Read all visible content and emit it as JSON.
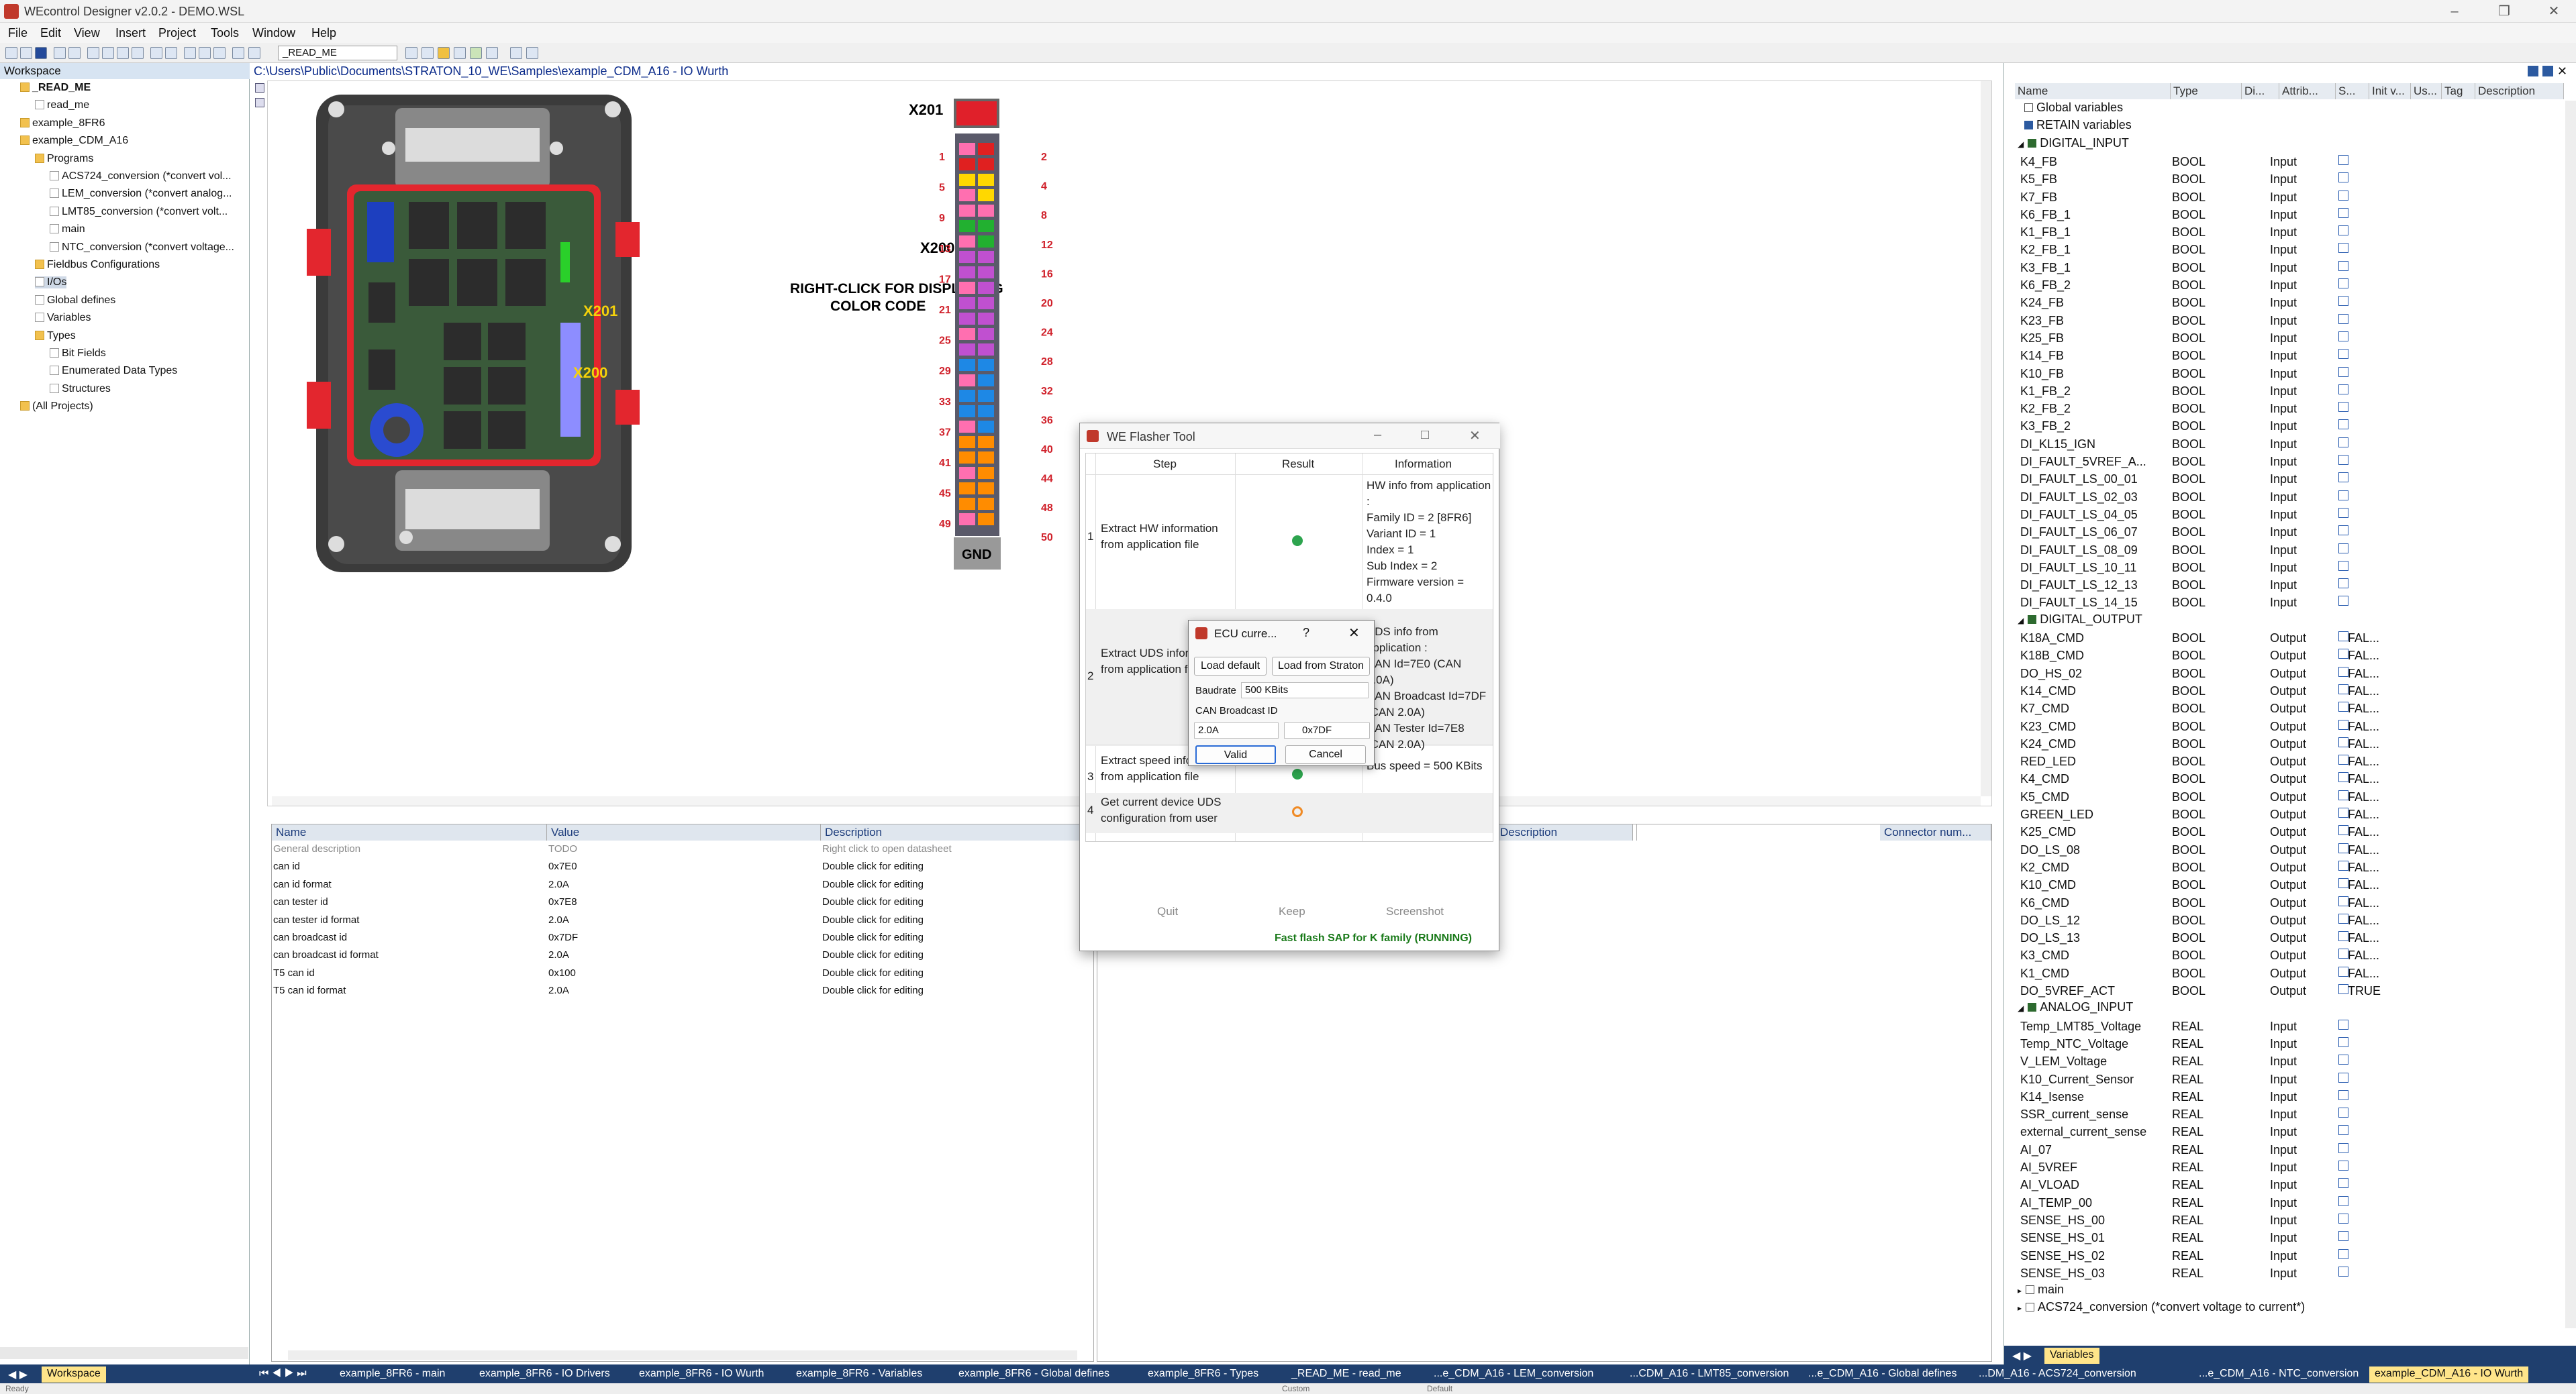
{
  "window": {
    "title": "WEcontrol Designer v2.0.2 - DEMO.WSL"
  },
  "menu": [
    "File",
    "Edit",
    "View",
    "Insert",
    "Project",
    "Tools",
    "Window",
    "Help"
  ],
  "toolbar": {
    "combo": "_READ_ME"
  },
  "workspace": {
    "header": "Workspace",
    "items": [
      {
        "label": "_READ_ME",
        "level": 0,
        "bold": true
      },
      {
        "label": "read_me",
        "level": 1
      },
      {
        "label": "example_8FR6",
        "level": 0
      },
      {
        "label": "example_CDM_A16",
        "level": 0
      },
      {
        "label": "Programs",
        "level": 1
      },
      {
        "label": "ACS724_conversion (*convert vol...",
        "level": 2
      },
      {
        "label": "LEM_conversion (*convert analog...",
        "level": 2
      },
      {
        "label": "LMT85_conversion (*convert volt...",
        "level": 2
      },
      {
        "label": "main",
        "level": 2
      },
      {
        "label": "NTC_conversion (*convert voltage...",
        "level": 2
      },
      {
        "label": "Fieldbus Configurations",
        "level": 1
      },
      {
        "label": "I/Os",
        "level": 1,
        "selected": true
      },
      {
        "label": "Global defines",
        "level": 1
      },
      {
        "label": "Variables",
        "level": 1
      },
      {
        "label": "Types",
        "level": 1
      },
      {
        "label": "Bit Fields",
        "level": 2
      },
      {
        "label": "Enumerated Data Types",
        "level": 2
      },
      {
        "label": "Structures",
        "level": 2
      },
      {
        "label": "(All Projects)",
        "level": 0
      }
    ]
  },
  "path": "C:\\Users\\Public\\Documents\\STRATON_10_WE\\Samples\\example_CDM_A16 - IO Wurth",
  "board": {
    "x201": "X201",
    "x200": "X200",
    "label_x201": "X201",
    "label_x200": "X200",
    "gnd": "GND",
    "hint": "RIGHT-CLICK FOR DISPLAYING\nCOLOR CODE",
    "left_pins": [
      "1",
      "5",
      "9",
      "13",
      "17",
      "21",
      "25",
      "29",
      "33",
      "37",
      "41",
      "45",
      "49"
    ],
    "right_pins": [
      "2",
      "4",
      "8",
      "12",
      "16",
      "20",
      "24",
      "28",
      "32",
      "36",
      "40",
      "44",
      "48",
      "50"
    ]
  },
  "props": {
    "headers": [
      "Name",
      "Value",
      "Description"
    ],
    "rows": [
      [
        "General description",
        "TODO",
        "Right click to open datasheet"
      ],
      [
        "can id",
        "0x7E0",
        "Double click for editing"
      ],
      [
        "can id format",
        "2.0A",
        "Double click for editing"
      ],
      [
        "can tester id",
        "0x7E8",
        "Double click for editing"
      ],
      [
        "can tester id format",
        "2.0A",
        "Double click for editing"
      ],
      [
        "can broadcast id",
        "0x7DF",
        "Double click for editing"
      ],
      [
        "can broadcast id format",
        "2.0A",
        "Double click for editing"
      ],
      [
        "T5 can id",
        "0x100",
        "Double click for editing"
      ],
      [
        "T5 can id format",
        "2.0A",
        "Double click for editing"
      ]
    ]
  },
  "io": {
    "headers": [
      "Description",
      "Connector num..."
    ]
  },
  "flasher": {
    "title": "WE Flasher Tool",
    "cols": [
      "Step",
      "Result",
      "Information"
    ],
    "steps": [
      {
        "n": "1",
        "step": "Extract HW information from application file",
        "result": "ok",
        "info": "HW info from application :\nFamily ID = 2 [8FR6]\nVariant ID = 1\nIndex = 1\nSub Index = 2\nFirmware version = 0.4.0"
      },
      {
        "n": "2",
        "step": "Extract UDS information from application file",
        "result": "",
        "info": "UDS info from application :\nCAN Id=7E0 (CAN 2.0A)\nCAN Broadcast Id=7DF (CAN 2.0A)\nCAN Tester Id=7E8 (CAN 2.0A)"
      },
      {
        "n": "3",
        "step": "Extract speed information from application file",
        "result": "ok",
        "info": "Bus speed = 500 KBits"
      },
      {
        "n": "4",
        "step": "Get current device UDS configuration from user",
        "result": "busy",
        "info": ""
      }
    ],
    "buttons": [
      "Quit",
      "Keep",
      "Screenshot"
    ],
    "status": "Fast flash SAP for K family (RUNNING)"
  },
  "ecu": {
    "title": "ECU curre...",
    "help": "?",
    "load_default": "Load default",
    "load_straton": "Load from Straton",
    "baudrate_label": "Baudrate",
    "baudrate": "500 KBits",
    "broadcast_label": "CAN Broadcast ID",
    "format": "2.0A",
    "id": "0x7DF",
    "valid": "Valid",
    "cancel": "Cancel"
  },
  "vars": {
    "headers": [
      "Name",
      "Type",
      "Di...",
      "Attrib...",
      "S...",
      "Init v...",
      "Us...",
      "Tag",
      "Description"
    ],
    "global": "Global variables",
    "retain": "RETAIN variables",
    "groups": [
      {
        "name": "DIGITAL_INPUT",
        "rows": [
          [
            "K4_FB",
            "BOOL",
            "Input",
            ""
          ],
          [
            "K5_FB",
            "BOOL",
            "Input",
            ""
          ],
          [
            "K7_FB",
            "BOOL",
            "Input",
            ""
          ],
          [
            "K6_FB_1",
            "BOOL",
            "Input",
            ""
          ],
          [
            "K1_FB_1",
            "BOOL",
            "Input",
            ""
          ],
          [
            "K2_FB_1",
            "BOOL",
            "Input",
            ""
          ],
          [
            "K3_FB_1",
            "BOOL",
            "Input",
            ""
          ],
          [
            "K6_FB_2",
            "BOOL",
            "Input",
            ""
          ],
          [
            "K24_FB",
            "BOOL",
            "Input",
            ""
          ],
          [
            "K23_FB",
            "BOOL",
            "Input",
            ""
          ],
          [
            "K25_FB",
            "BOOL",
            "Input",
            ""
          ],
          [
            "K14_FB",
            "BOOL",
            "Input",
            ""
          ],
          [
            "K10_FB",
            "BOOL",
            "Input",
            ""
          ],
          [
            "K1_FB_2",
            "BOOL",
            "Input",
            ""
          ],
          [
            "K2_FB_2",
            "BOOL",
            "Input",
            ""
          ],
          [
            "K3_FB_2",
            "BOOL",
            "Input",
            ""
          ],
          [
            "DI_KL15_IGN",
            "BOOL",
            "Input",
            ""
          ],
          [
            "DI_FAULT_5VREF_A...",
            "BOOL",
            "Input",
            ""
          ],
          [
            "DI_FAULT_LS_00_01",
            "BOOL",
            "Input",
            ""
          ],
          [
            "DI_FAULT_LS_02_03",
            "BOOL",
            "Input",
            ""
          ],
          [
            "DI_FAULT_LS_04_05",
            "BOOL",
            "Input",
            ""
          ],
          [
            "DI_FAULT_LS_06_07",
            "BOOL",
            "Input",
            ""
          ],
          [
            "DI_FAULT_LS_08_09",
            "BOOL",
            "Input",
            ""
          ],
          [
            "DI_FAULT_LS_10_11",
            "BOOL",
            "Input",
            ""
          ],
          [
            "DI_FAULT_LS_12_13",
            "BOOL",
            "Input",
            ""
          ],
          [
            "DI_FAULT_LS_14_15",
            "BOOL",
            "Input",
            ""
          ]
        ]
      },
      {
        "name": "DIGITAL_OUTPUT",
        "rows": [
          [
            "K18A_CMD",
            "BOOL",
            "Output",
            "FAL..."
          ],
          [
            "K18B_CMD",
            "BOOL",
            "Output",
            "FAL..."
          ],
          [
            "DO_HS_02",
            "BOOL",
            "Output",
            "FAL..."
          ],
          [
            "K14_CMD",
            "BOOL",
            "Output",
            "FAL..."
          ],
          [
            "K7_CMD",
            "BOOL",
            "Output",
            "FAL..."
          ],
          [
            "K23_CMD",
            "BOOL",
            "Output",
            "FAL..."
          ],
          [
            "K24_CMD",
            "BOOL",
            "Output",
            "FAL..."
          ],
          [
            "RED_LED",
            "BOOL",
            "Output",
            "FAL..."
          ],
          [
            "K4_CMD",
            "BOOL",
            "Output",
            "FAL..."
          ],
          [
            "K5_CMD",
            "BOOL",
            "Output",
            "FAL..."
          ],
          [
            "GREEN_LED",
            "BOOL",
            "Output",
            "FAL..."
          ],
          [
            "K25_CMD",
            "BOOL",
            "Output",
            "FAL..."
          ],
          [
            "DO_LS_08",
            "BOOL",
            "Output",
            "FAL..."
          ],
          [
            "K2_CMD",
            "BOOL",
            "Output",
            "FAL..."
          ],
          [
            "K10_CMD",
            "BOOL",
            "Output",
            "FAL..."
          ],
          [
            "K6_CMD",
            "BOOL",
            "Output",
            "FAL..."
          ],
          [
            "DO_LS_12",
            "BOOL",
            "Output",
            "FAL..."
          ],
          [
            "DO_LS_13",
            "BOOL",
            "Output",
            "FAL..."
          ],
          [
            "K3_CMD",
            "BOOL",
            "Output",
            "FAL..."
          ],
          [
            "K1_CMD",
            "BOOL",
            "Output",
            "FAL..."
          ],
          [
            "DO_5VREF_ACT",
            "BOOL",
            "Output",
            "TRUE"
          ]
        ]
      },
      {
        "name": "ANALOG_INPUT",
        "rows": [
          [
            "Temp_LMT85_Voltage",
            "REAL",
            "Input",
            ""
          ],
          [
            "Temp_NTC_Voltage",
            "REAL",
            "Input",
            ""
          ],
          [
            "V_LEM_Voltage",
            "REAL",
            "Input",
            ""
          ],
          [
            "K10_Current_Sensor",
            "REAL",
            "Input",
            ""
          ],
          [
            "K14_Isense",
            "REAL",
            "Input",
            ""
          ],
          [
            "SSR_current_sense",
            "REAL",
            "Input",
            ""
          ],
          [
            "external_current_sense",
            "REAL",
            "Input",
            ""
          ],
          [
            "AI_07",
            "REAL",
            "Input",
            ""
          ],
          [
            "AI_5VREF",
            "REAL",
            "Input",
            ""
          ],
          [
            "AI_VLOAD",
            "REAL",
            "Input",
            ""
          ],
          [
            "AI_TEMP_00",
            "REAL",
            "Input",
            ""
          ],
          [
            "SENSE_HS_00",
            "REAL",
            "Input",
            ""
          ],
          [
            "SENSE_HS_01",
            "REAL",
            "Input",
            ""
          ],
          [
            "SENSE_HS_02",
            "REAL",
            "Input",
            ""
          ],
          [
            "SENSE_HS_03",
            "REAL",
            "Input",
            ""
          ]
        ]
      }
    ],
    "tail": [
      "main",
      "ACS724_conversion (*convert voltage to current*)"
    ],
    "tab": "Variables"
  },
  "tabs": [
    "Workspace",
    "example_8FR6 - main",
    "example_8FR6 - IO Drivers",
    "example_8FR6 - IO Wurth",
    "example_8FR6 - Variables",
    "example_8FR6 - Global defines",
    "example_8FR6 - Types",
    "_READ_ME - read_me",
    "...e_CDM_A16 - LEM_conversion",
    "...CDM_A16 - LMT85_conversion",
    "...e_CDM_A16 - Global defines",
    "...DM_A16 - ACS724_conversion",
    "...e_CDM_A16 - NTC_conversion",
    "example_CDM_A16 - IO Wurth"
  ],
  "status": [
    "Ready",
    "Custom",
    "Default"
  ]
}
